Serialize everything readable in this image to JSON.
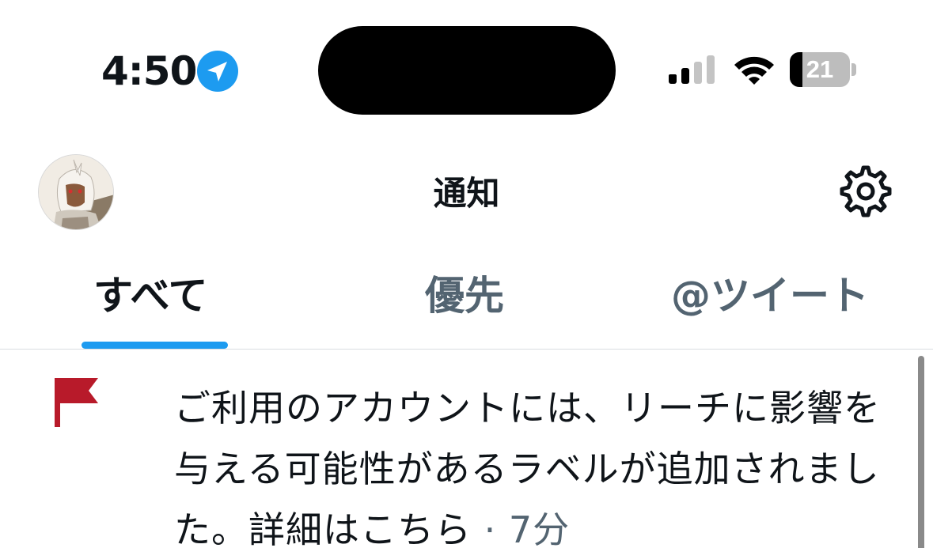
{
  "status_bar": {
    "time": "4:50",
    "battery_percent": "21",
    "battery_level": 0.21,
    "location_icon": "location-arrow-icon",
    "signal_icon": "cellular-signal-icon",
    "wifi_icon": "wifi-icon"
  },
  "header": {
    "title": "通知",
    "avatar_icon": "profile-avatar",
    "settings_icon": "gear-icon"
  },
  "tabs": {
    "all": "すべて",
    "priority": "優先",
    "mentions": "@ツイート",
    "active": "all"
  },
  "notification": {
    "icon": "flag-icon",
    "message": "ご利用のアカウントには、リーチに影響を与える可能性があるラベルが追加されました。詳細はこちら",
    "time": " · 7分"
  },
  "colors": {
    "accent": "#1d9bf0",
    "flag": "#b81a2a",
    "secondary_text": "#536471",
    "primary_text": "#0f1419"
  }
}
